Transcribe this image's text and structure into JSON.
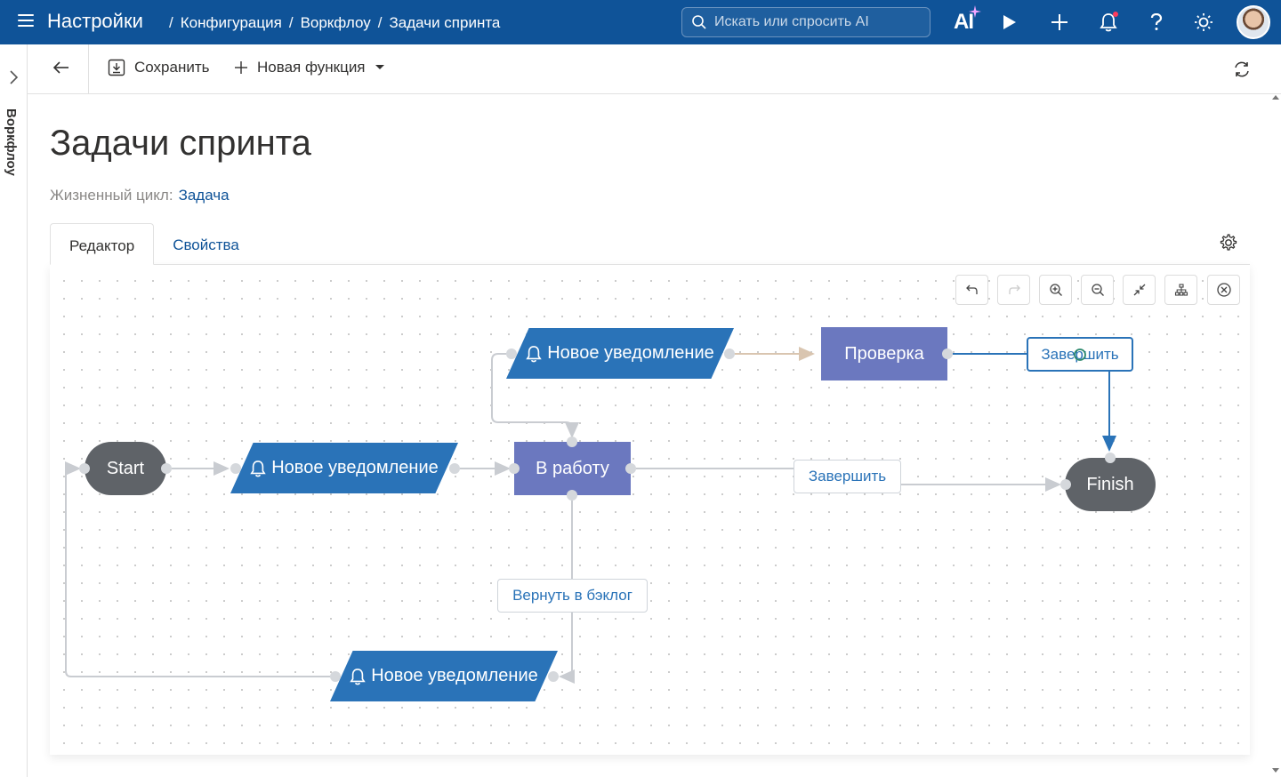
{
  "header": {
    "app_title": "Настройки",
    "breadcrumb": [
      "Конфигурация",
      "Воркфлоу",
      "Задачи спринта"
    ],
    "breadcrumb_sep": "/",
    "search_placeholder": "Искать или спросить AI",
    "ai_label": "AI"
  },
  "sidebar": {
    "label": "Воркфлоу"
  },
  "toolbar": {
    "save_label": "Сохранить",
    "new_function_label": "Новая функция"
  },
  "page": {
    "title": "Задачи спринта",
    "lifecycle_label": "Жизненный цикл:",
    "lifecycle_value": "Задача"
  },
  "tabs": [
    {
      "label": "Редактор",
      "active": true
    },
    {
      "label": "Свойства",
      "active": false
    }
  ],
  "diagram": {
    "nodes": {
      "start": "Start",
      "notify_1": "Новое уведомление",
      "notify_2": "Новое уведомление",
      "notify_3": "Новое уведомление",
      "in_work": "В работу",
      "review": "Проверка",
      "finish": "Finish"
    },
    "edge_labels": {
      "complete_1": "Завершить",
      "complete_2": "Завершить",
      "return_backlog": "Вернуть в бэклог"
    }
  },
  "colors": {
    "header_bg": "#0f5398",
    "state_node": "#6b78bf",
    "action_node": "#2a73b8",
    "terminal_node": "#5f6368",
    "link": "#0f5398"
  }
}
